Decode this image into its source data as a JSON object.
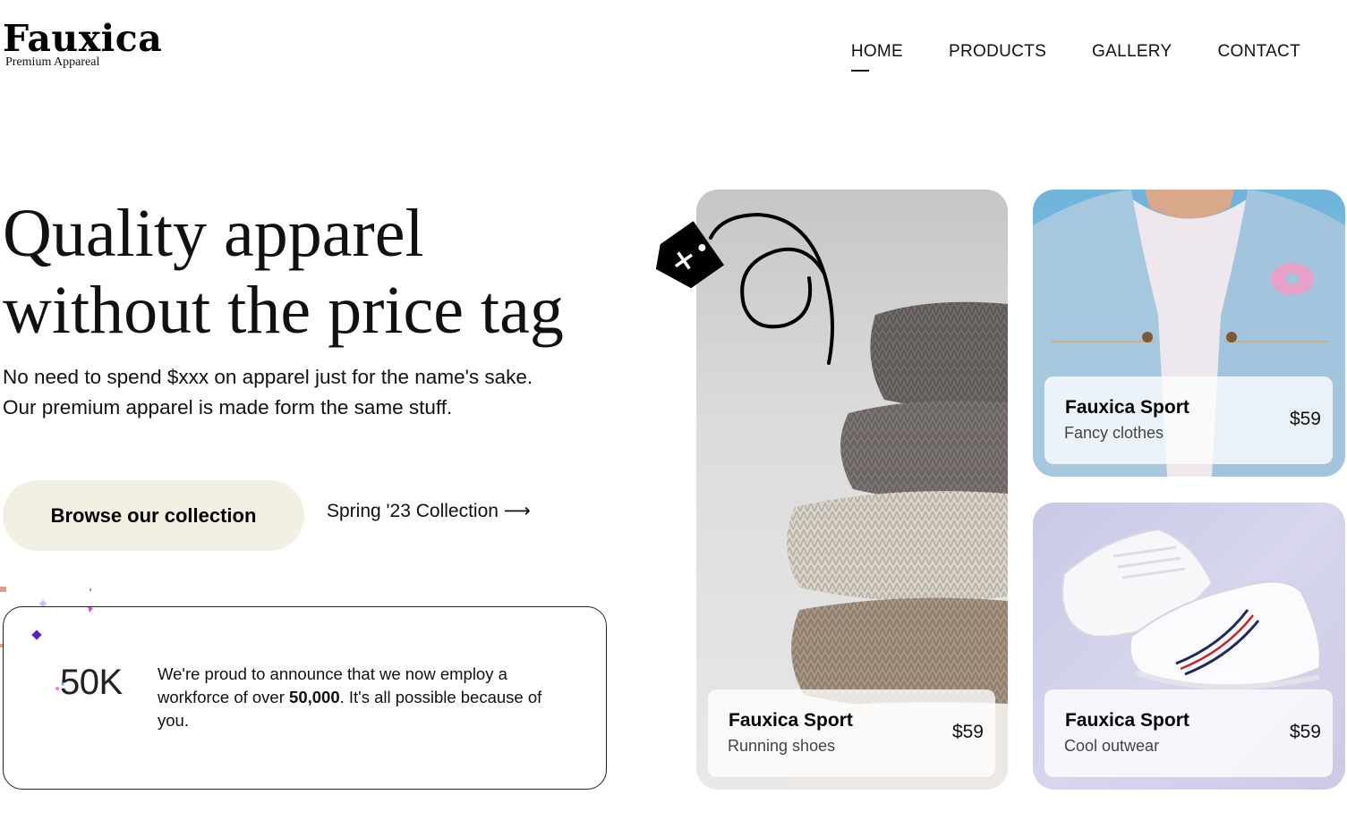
{
  "brand": {
    "name": "Fauxica",
    "tagline": "Premium Appareal"
  },
  "nav": {
    "items": [
      {
        "label": "HOME",
        "active": true
      },
      {
        "label": "PRODUCTS",
        "active": false
      },
      {
        "label": "GALLERY",
        "active": false
      },
      {
        "label": "CONTACT",
        "active": false
      }
    ]
  },
  "hero": {
    "title_line1": "Quality apparel",
    "title_line2": "without the price tag",
    "subtitle_line1": "No need to spend $xxx on apparel just for the name's sake.",
    "subtitle_line2": "Our premium apparel is made form the same stuff.",
    "cta_label": "Browse our collection",
    "link_label": "Spring '23 Collection ⟶"
  },
  "stat": {
    "number": "50K",
    "text_before": "We're proud to announce that we now employ a workforce of over ",
    "text_bold": "50,000",
    "text_after": ". It's all possible because of you."
  },
  "products": [
    {
      "title": "Fauxica Sport",
      "subtitle": "Running shoes",
      "price": "$59"
    },
    {
      "title": "Fauxica Sport",
      "subtitle": "Fancy clothes",
      "price": "$59"
    },
    {
      "title": "Fauxica Sport",
      "subtitle": "Cool outwear",
      "price": "$59"
    }
  ],
  "colors": {
    "cta_bg": "#f2f0e3",
    "text": "#111111"
  }
}
